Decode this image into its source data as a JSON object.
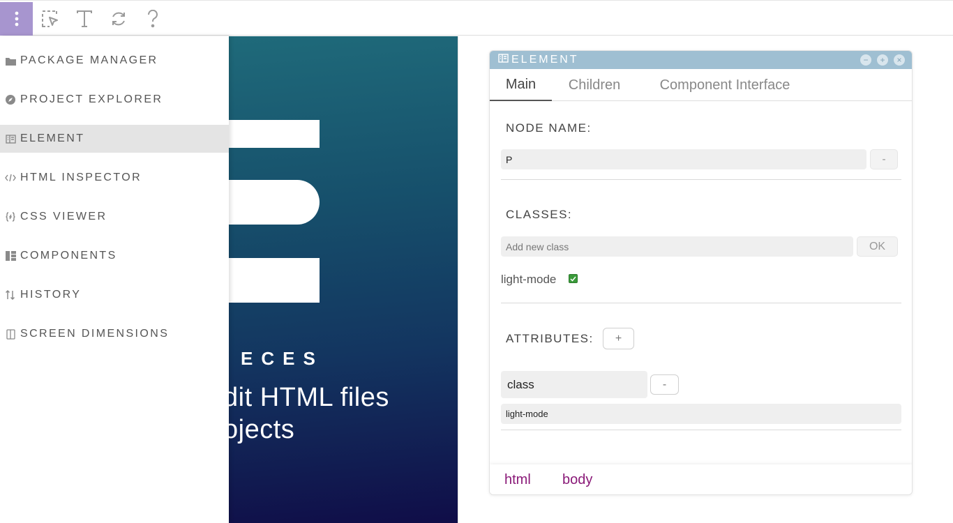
{
  "toolbar": {
    "buttons": [
      {
        "name": "more-vertical-icon",
        "active": true
      },
      {
        "name": "select-element-icon",
        "active": false
      },
      {
        "name": "text-icon",
        "active": false
      },
      {
        "name": "refresh-icon",
        "active": false
      },
      {
        "name": "help-icon",
        "active": false
      }
    ],
    "accent_color": "#a795cf"
  },
  "menu": {
    "items": [
      {
        "label": "PACKAGE MANAGER",
        "icon": "folder-icon",
        "active": false
      },
      {
        "label": "PROJECT EXPLORER",
        "icon": "compass-icon",
        "active": false
      },
      {
        "label": "ELEMENT",
        "icon": "element-panel-icon",
        "active": true
      },
      {
        "label": "HTML INSPECTOR",
        "icon": "code-icon",
        "active": false
      },
      {
        "label": "CSS VIEWER",
        "icon": "css-icon",
        "active": false
      },
      {
        "label": "COMPONENTS",
        "icon": "components-icon",
        "active": false
      },
      {
        "label": "HISTORY",
        "icon": "history-icon",
        "active": false
      },
      {
        "label": "SCREEN DIMENSIONS",
        "icon": "screen-icon",
        "active": false
      }
    ]
  },
  "canvas": {
    "brand": "ECES",
    "line1": "dit HTML files",
    "line2": "ojects"
  },
  "element_panel": {
    "title": "ELEMENT",
    "header_color": "#9fbfd2",
    "window_buttons": [
      "−",
      "+",
      "×"
    ],
    "tabs": [
      {
        "label": "Main",
        "active": true
      },
      {
        "label": "Children",
        "active": false
      },
      {
        "label": "Component Interface",
        "active": false
      }
    ],
    "node_name": {
      "label": "NODE NAME:",
      "value": "P",
      "remove_label": "-"
    },
    "classes": {
      "label": "CLASSES:",
      "placeholder": "Add new class",
      "ok_label": "OK",
      "items": [
        {
          "name": "light-mode",
          "checked": true
        }
      ]
    },
    "attributes": {
      "label": "ATTRIBUTES:",
      "add_label": "+",
      "items": [
        {
          "name": "class",
          "value": "light-mode",
          "remove_label": "-"
        }
      ]
    },
    "breadcrumb": [
      "html",
      "body"
    ],
    "breadcrumb_color": "#8a1a78"
  }
}
